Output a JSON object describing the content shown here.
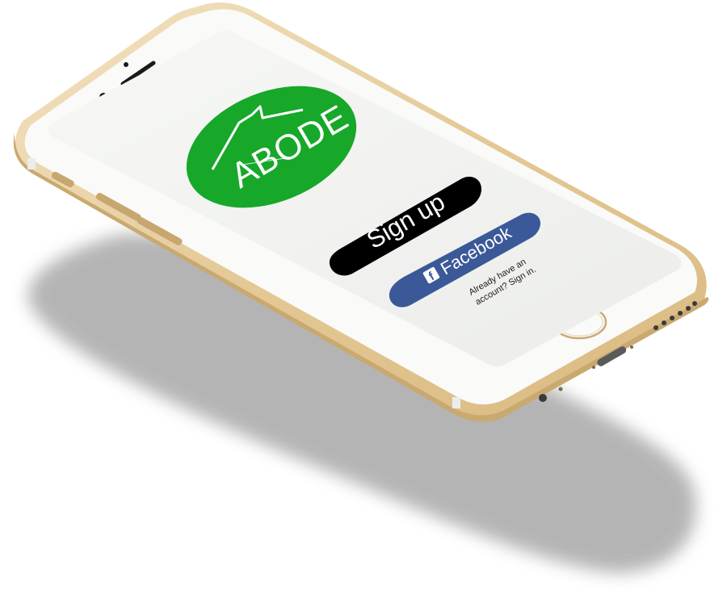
{
  "app": {
    "logo_text": "ABODE",
    "signup_label": "Sign up",
    "facebook_label": "Facebook",
    "signin_prompt_line1": "Already have an",
    "signin_prompt_line2": "account? Sign in."
  },
  "colors": {
    "brand_green": "#17A82A",
    "signup_button": "#000000",
    "facebook_blue": "#3B5998",
    "screen_bg": "#F1F2F0",
    "phone_body": "#E9D2A8",
    "shadow": "#9E9E9E"
  },
  "icons": {
    "facebook": "facebook-logo-icon",
    "logo_roof": "house-roof-icon"
  }
}
